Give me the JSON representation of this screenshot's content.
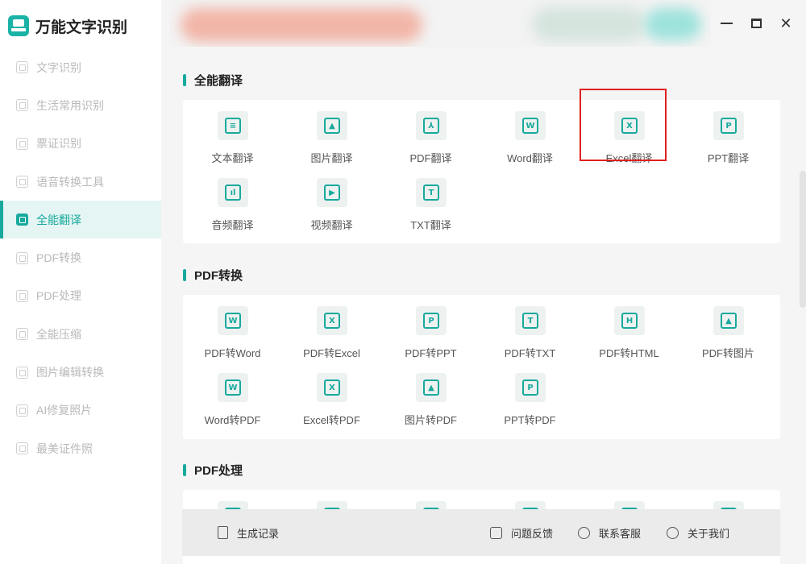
{
  "app": {
    "name": "万能文字识别"
  },
  "sidebar": {
    "items": [
      {
        "label": "文字识别",
        "icon": "scan-text-icon",
        "active": false
      },
      {
        "label": "生活常用识别",
        "icon": "scan-life-icon",
        "active": false
      },
      {
        "label": "票证识别",
        "icon": "scan-ticket-icon",
        "active": false
      },
      {
        "label": "语音转换工具",
        "icon": "voice-convert-icon",
        "active": false
      },
      {
        "label": "全能翻译",
        "icon": "translate-icon",
        "active": true
      },
      {
        "label": "PDF转换",
        "icon": "pdf-convert-icon",
        "active": false
      },
      {
        "label": "PDF处理",
        "icon": "pdf-process-icon",
        "active": false
      },
      {
        "label": "全能压缩",
        "icon": "compress-icon",
        "active": false
      },
      {
        "label": "图片编辑转换",
        "icon": "image-edit-icon",
        "active": false
      },
      {
        "label": "AI修复照片",
        "icon": "ai-repair-icon",
        "active": false
      },
      {
        "label": "最美证件照",
        "icon": "id-photo-icon",
        "active": false
      }
    ]
  },
  "sections": [
    {
      "title": "全能翻译",
      "tiles": [
        {
          "label": "文本翻译",
          "icon": "text-translate-icon",
          "glyph": "≡"
        },
        {
          "label": "图片翻译",
          "icon": "image-translate-icon",
          "glyph": "▲"
        },
        {
          "label": "PDF翻译",
          "icon": "pdf-translate-icon",
          "glyph": "⅄"
        },
        {
          "label": "Word翻译",
          "icon": "word-translate-icon",
          "glyph": "W"
        },
        {
          "label": "Excel翻译",
          "icon": "excel-translate-icon",
          "glyph": "X",
          "highlighted": true
        },
        {
          "label": "PPT翻译",
          "icon": "ppt-translate-icon",
          "glyph": "P"
        },
        {
          "label": "音频翻译",
          "icon": "audio-translate-icon",
          "glyph": "ıl"
        },
        {
          "label": "视频翻译",
          "icon": "video-translate-icon",
          "glyph": "▶"
        },
        {
          "label": "TXT翻译",
          "icon": "txt-translate-icon",
          "glyph": "T"
        }
      ]
    },
    {
      "title": "PDF转换",
      "tiles": [
        {
          "label": "PDF转Word",
          "icon": "pdf-to-word-icon",
          "glyph": "W"
        },
        {
          "label": "PDF转Excel",
          "icon": "pdf-to-excel-icon",
          "glyph": "X"
        },
        {
          "label": "PDF转PPT",
          "icon": "pdf-to-ppt-icon",
          "glyph": "P"
        },
        {
          "label": "PDF转TXT",
          "icon": "pdf-to-txt-icon",
          "glyph": "T"
        },
        {
          "label": "PDF转HTML",
          "icon": "pdf-to-html-icon",
          "glyph": "H"
        },
        {
          "label": "PDF转图片",
          "icon": "pdf-to-image-icon",
          "glyph": "▲"
        },
        {
          "label": "Word转PDF",
          "icon": "word-to-pdf-icon",
          "glyph": "W"
        },
        {
          "label": "Excel转PDF",
          "icon": "excel-to-pdf-icon",
          "glyph": "X"
        },
        {
          "label": "图片转PDF",
          "icon": "image-to-pdf-icon",
          "glyph": "▲"
        },
        {
          "label": "PPT转PDF",
          "icon": "ppt-to-pdf-icon",
          "glyph": "P"
        }
      ]
    },
    {
      "title": "PDF处理",
      "tiles": [
        {
          "label": "",
          "icon": "pdf-process-tool-icon",
          "glyph": ""
        },
        {
          "label": "",
          "icon": "pdf-process-tool-icon",
          "glyph": ""
        },
        {
          "label": "",
          "icon": "pdf-process-tool-icon",
          "glyph": ""
        },
        {
          "label": "",
          "icon": "pdf-process-tool-icon",
          "glyph": ""
        },
        {
          "label": "",
          "icon": "pdf-process-tool-icon",
          "glyph": ""
        },
        {
          "label": "",
          "icon": "pdf-process-tool-icon",
          "glyph": ""
        }
      ]
    }
  ],
  "bottom_bar": {
    "history": "生成记录",
    "feedback": "问题反馈",
    "support": "联系客服",
    "about": "关于我们"
  },
  "window": {
    "minimize": "—",
    "maximize": "□",
    "close": "✕"
  },
  "colors": {
    "accent": "#18a99d",
    "highlight_box": "#e02020"
  }
}
